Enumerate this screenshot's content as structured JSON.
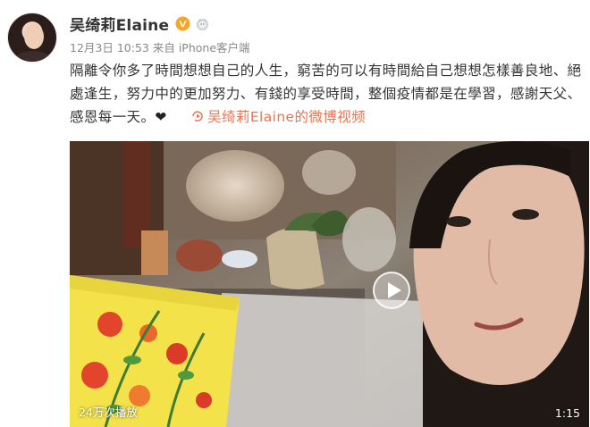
{
  "post": {
    "username": "吴绮莉Elaine",
    "date": "12月3日 10:53",
    "source": "来自 iPhone客户端",
    "text": "隔離令你多了時間想想自己的人生，窮苦的可以有時間給自己想想怎樣善良地、絕處逢生，努力中的更加努力、有錢的享受時間，整個疫情都是在學習，感謝天父、感恩每一天。",
    "emoji": "❤",
    "video_link_label": "吴绮莉Elaine的微博视频"
  },
  "video": {
    "views": "24万次播放",
    "duration": "1:15"
  },
  "colors": {
    "link": "#eb7350",
    "verified_badge": "#f6a623",
    "meta_text": "#888888"
  },
  "icons": [
    "verified-v-icon",
    "rank-badge-icon",
    "heart-icon",
    "video-link-icon",
    "play-icon"
  ]
}
